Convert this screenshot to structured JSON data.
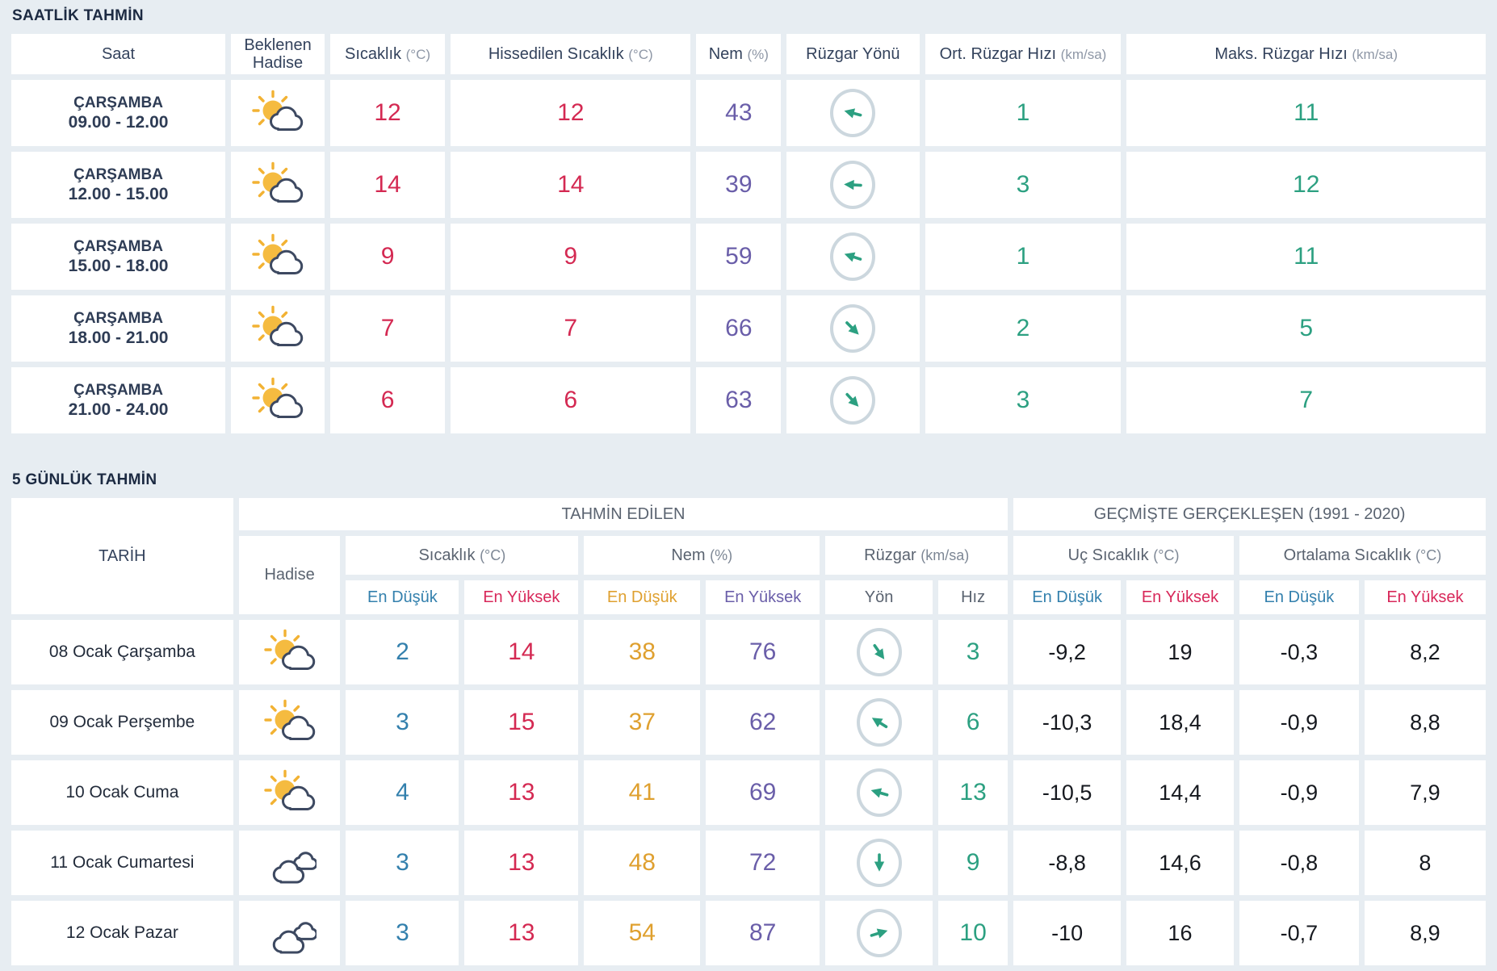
{
  "colors": {
    "page_bg": "#e7edf2",
    "cell_bg": "#ffffff",
    "accent_red": "#d42952",
    "accent_blue": "#3380ad",
    "accent_orange": "#dfa02f",
    "accent_purple": "#6a5ea9",
    "accent_green": "#2ca081",
    "navy_text": "#2e3c55"
  },
  "hourly": {
    "title": "SAATLİK TAHMİN",
    "columns": [
      {
        "label": "Saat",
        "unit": ""
      },
      {
        "label": "Beklenen Hadise",
        "unit": ""
      },
      {
        "label": "Sıcaklık",
        "unit": "(°C)"
      },
      {
        "label": "Hissedilen Sıcaklık",
        "unit": "(°C)"
      },
      {
        "label": "Nem",
        "unit": "(%)"
      },
      {
        "label": "Rüzgar Yönü",
        "unit": ""
      },
      {
        "label": "Ort. Rüzgar Hızı",
        "unit": "(km/sa)"
      },
      {
        "label": "Maks. Rüzgar Hızı",
        "unit": "(km/sa)"
      }
    ],
    "rows": [
      {
        "day": "ÇARŞAMBA",
        "time": "09.00 - 12.00",
        "icon": "sun-cloud",
        "temp": "12",
        "feels": "12",
        "humidity": "43",
        "wind_dir_deg": 195,
        "wind_avg": "1",
        "wind_max": "11"
      },
      {
        "day": "ÇARŞAMBA",
        "time": "12.00 - 15.00",
        "icon": "sun-cloud",
        "temp": "14",
        "feels": "14",
        "humidity": "39",
        "wind_dir_deg": 183,
        "wind_avg": "3",
        "wind_max": "12"
      },
      {
        "day": "ÇARŞAMBA",
        "time": "15.00 - 18.00",
        "icon": "sun-cloud",
        "temp": "9",
        "feels": "9",
        "humidity": "59",
        "wind_dir_deg": 198,
        "wind_avg": "1",
        "wind_max": "11"
      },
      {
        "day": "ÇARŞAMBA",
        "time": "18.00 - 21.00",
        "icon": "sun-cloud",
        "temp": "7",
        "feels": "7",
        "humidity": "66",
        "wind_dir_deg": 45,
        "wind_avg": "2",
        "wind_max": "5"
      },
      {
        "day": "ÇARŞAMBA",
        "time": "21.00 - 24.00",
        "icon": "sun-cloud",
        "temp": "6",
        "feels": "6",
        "humidity": "63",
        "wind_dir_deg": 47,
        "wind_avg": "3",
        "wind_max": "7"
      }
    ]
  },
  "daily": {
    "title": "5 GÜNLÜK TAHMİN",
    "headers": {
      "tarih": "TARİH",
      "tahmin_edilen": "TAHMİN EDİLEN",
      "gecmiste": "GEÇMİŞTE GERÇEKLEŞEN (1991 - 2020)",
      "hadise": "Hadise",
      "sicaklik": {
        "label": "Sıcaklık",
        "unit": "(°C)"
      },
      "nem": {
        "label": "Nem",
        "unit": "(%)"
      },
      "ruzgar": {
        "label": "Rüzgar",
        "unit": "(km/sa)"
      },
      "uc": {
        "label": "Uç Sıcaklık",
        "unit": "(°C)"
      },
      "ortalama": {
        "label": "Ortalama Sıcaklık",
        "unit": "(°C)"
      },
      "en_dusuk": "En Düşük",
      "en_yuksek": "En Yüksek",
      "yon": "Yön",
      "hiz": "Hız"
    },
    "rows": [
      {
        "date": "08 Ocak Çarşamba",
        "icon": "sun-cloud",
        "tmin": "2",
        "tmax": "14",
        "hmin": "38",
        "hmax": "76",
        "wind_dir_deg": 55,
        "wind_speed": "3",
        "ext_min": "-9,2",
        "ext_max": "19",
        "avg_min": "-0,3",
        "avg_max": "8,2"
      },
      {
        "date": "09 Ocak Perşembe",
        "icon": "sun-cloud",
        "tmin": "3",
        "tmax": "15",
        "hmin": "37",
        "hmax": "62",
        "wind_dir_deg": 212,
        "wind_speed": "6",
        "ext_min": "-10,3",
        "ext_max": "18,4",
        "avg_min": "-0,9",
        "avg_max": "8,8"
      },
      {
        "date": "10 Ocak Cuma",
        "icon": "sun-cloud",
        "tmin": "4",
        "tmax": "13",
        "hmin": "41",
        "hmax": "69",
        "wind_dir_deg": 196,
        "wind_speed": "13",
        "ext_min": "-10,5",
        "ext_max": "14,4",
        "avg_min": "-0,9",
        "avg_max": "7,9"
      },
      {
        "date": "11 Ocak Cumartesi",
        "icon": "clouds",
        "tmin": "3",
        "tmax": "13",
        "hmin": "48",
        "hmax": "72",
        "wind_dir_deg": 90,
        "wind_speed": "9",
        "ext_min": "-8,8",
        "ext_max": "14,6",
        "avg_min": "-0,8",
        "avg_max": "8"
      },
      {
        "date": "12 Ocak Pazar",
        "icon": "clouds",
        "tmin": "3",
        "tmax": "13",
        "hmin": "54",
        "hmax": "87",
        "wind_dir_deg": 343,
        "wind_speed": "10",
        "ext_min": "-10",
        "ext_max": "16",
        "avg_min": "-0,7",
        "avg_max": "8,9"
      }
    ]
  }
}
